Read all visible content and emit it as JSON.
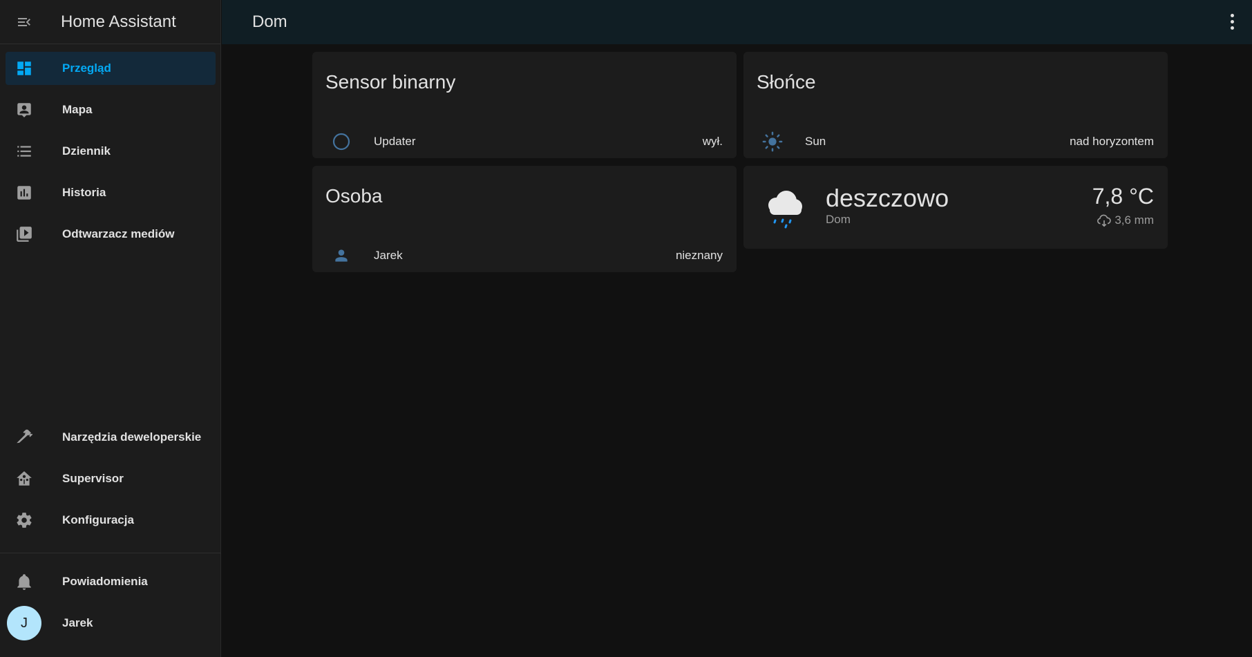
{
  "sidebar": {
    "title": "Home Assistant",
    "menu_icon": "menu-open-icon",
    "top_items": [
      {
        "label": "Przegląd",
        "icon": "view-dashboard-icon",
        "active": true
      },
      {
        "label": "Mapa",
        "icon": "account-box-icon"
      },
      {
        "label": "Dziennik",
        "icon": "format-list-bulleted-icon"
      },
      {
        "label": "Historia",
        "icon": "chart-box-icon"
      },
      {
        "label": "Odtwarzacz mediów",
        "icon": "play-box-multiple-icon"
      }
    ],
    "bottom_items": [
      {
        "label": "Narzędzia deweloperskie",
        "icon": "hammer-icon"
      },
      {
        "label": "Supervisor",
        "icon": "home-assistant-icon"
      },
      {
        "label": "Konfiguracja",
        "icon": "cog-icon"
      }
    ],
    "notifications_label": "Powiadomienia",
    "user": {
      "name": "Jarek",
      "initial": "J"
    }
  },
  "topbar": {
    "title": "Dom"
  },
  "cards": {
    "binary_sensor": {
      "title": "Sensor binarny",
      "entity": "Updater",
      "state": "wył."
    },
    "sun": {
      "title": "Słońce",
      "entity": "Sun",
      "state": "nad horyzontem"
    },
    "person": {
      "title": "Osoba",
      "entity": "Jarek",
      "state": "nieznany"
    },
    "weather": {
      "state": "deszczowo",
      "location": "Dom",
      "temperature": "7,8 °C",
      "precipitation": "3,6 mm"
    }
  },
  "colors": {
    "accent": "#03a9f4",
    "icon_blue": "#44739e",
    "sidebar_bg": "#1c1c1c",
    "topbar_bg": "#101e24"
  }
}
